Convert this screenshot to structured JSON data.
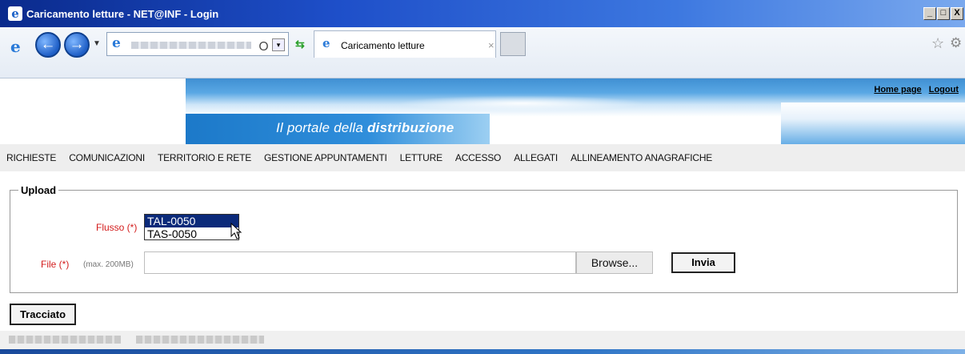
{
  "window": {
    "title": "Caricamento letture - NET@INF - Login",
    "controls": {
      "minimize": "_",
      "maximize": "□",
      "close": "X"
    }
  },
  "browser": {
    "back_icon": "back-arrow-icon",
    "forward_icon": "forward-arrow-icon",
    "address_search_icon": "Ｏ",
    "address_dropdown": "▾",
    "tab_label": "Caricamento letture",
    "tab_close": "×"
  },
  "header": {
    "tagline_prefix": "Il portale della ",
    "tagline_bold": "distribuzione",
    "links": {
      "home": "Home page",
      "logout": "Logout"
    }
  },
  "menu": {
    "items": [
      "RICHIESTE",
      "COMUNICAZIONI",
      "TERRITORIO E RETE",
      "GESTIONE APPUNTAMENTI",
      "LETTURE",
      "ACCESSO",
      "ALLEGATI",
      "ALLINEAMENTO ANAGRAFICHE"
    ]
  },
  "upload": {
    "legend": "Upload",
    "flusso_label": "Flusso (*)",
    "flusso_options": [
      "TAL-0050",
      "TAS-0050"
    ],
    "flusso_selected": "TAL-0050",
    "file_label": "File (*)",
    "file_hint": "(max. 200MB)",
    "file_value": "",
    "browse_label": "Browse...",
    "submit_label": "Invia"
  },
  "tracciato_label": "Tracciato",
  "colors": {
    "required_label": "#d31b1b",
    "selected_option": "#0b2a7a",
    "banner_blue": "#1c79c9"
  }
}
